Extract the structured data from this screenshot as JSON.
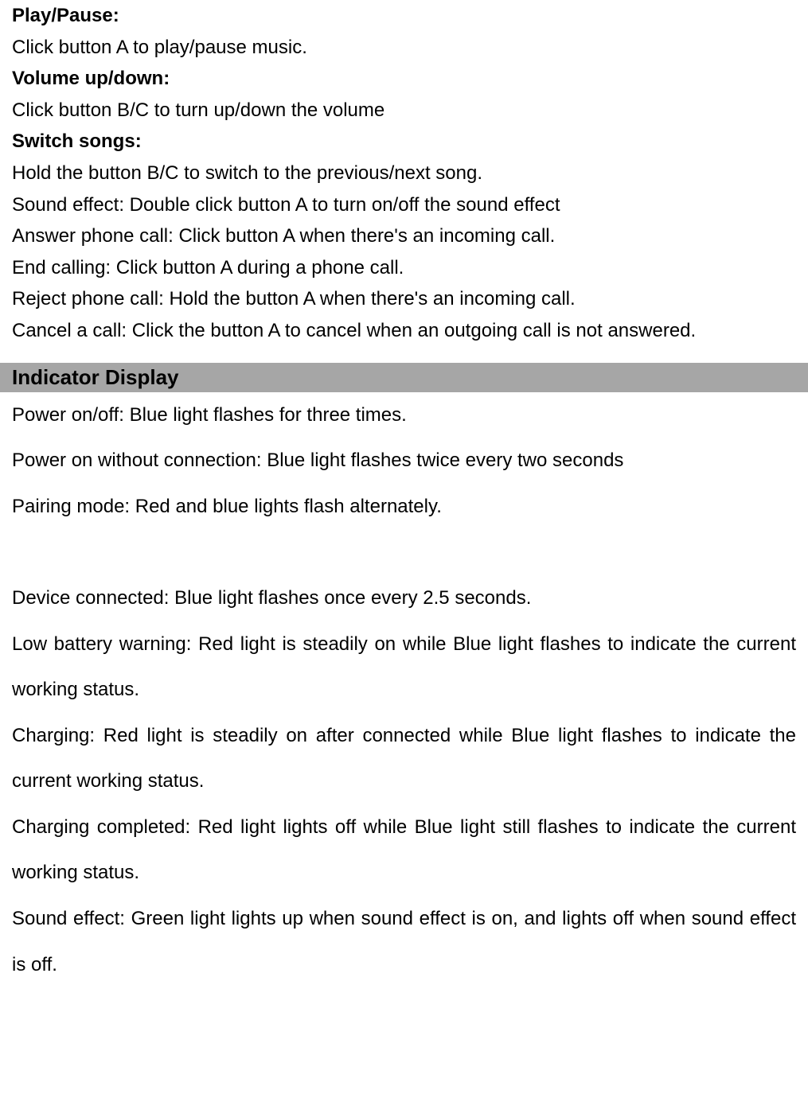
{
  "controls": {
    "playPause": {
      "heading": "Play/Pause:",
      "text": "Click button A to play/pause music."
    },
    "volume": {
      "heading": "Volume up/down:",
      "text": "Click button B/C to turn up/down the volume"
    },
    "switchSongs": {
      "heading": "Switch songs:",
      "text": "Hold the button B/C to switch to the previous/next song."
    },
    "soundEffect": "Sound effect: Double click button A to turn on/off the sound effect",
    "answerCall": "Answer phone call: Click button A when there's an incoming call.",
    "endCall": "End calling: Click button A during a phone call.",
    "rejectCall": "Reject phone call: Hold the button A when there's an incoming call.",
    "cancelCall": "Cancel a call: Click the button A to cancel when an outgoing call is not answered."
  },
  "indicatorDisplay": {
    "heading": "Indicator Display",
    "powerOnOff": "Power on/off: Blue light flashes for three times.",
    "powerOnNoConn": "Power on without connection: Blue light flashes twice every two seconds",
    "pairing": "Pairing mode: Red and blue lights flash alternately.",
    "deviceConnected": "Device connected: Blue light flashes once every 2.5 seconds.",
    "lowBattery": "Low battery warning: Red light is steadily on while Blue light flashes to indicate the current working status.",
    "charging": "Charging: Red light is steadily on after connected while Blue light flashes to indicate the current working status.",
    "chargingComplete": "Charging completed: Red light lights off while Blue light still flashes to indicate the current working status.",
    "soundEffectIndicator": "Sound effect: Green light lights up when sound effect is on, and lights off when sound effect is off."
  }
}
